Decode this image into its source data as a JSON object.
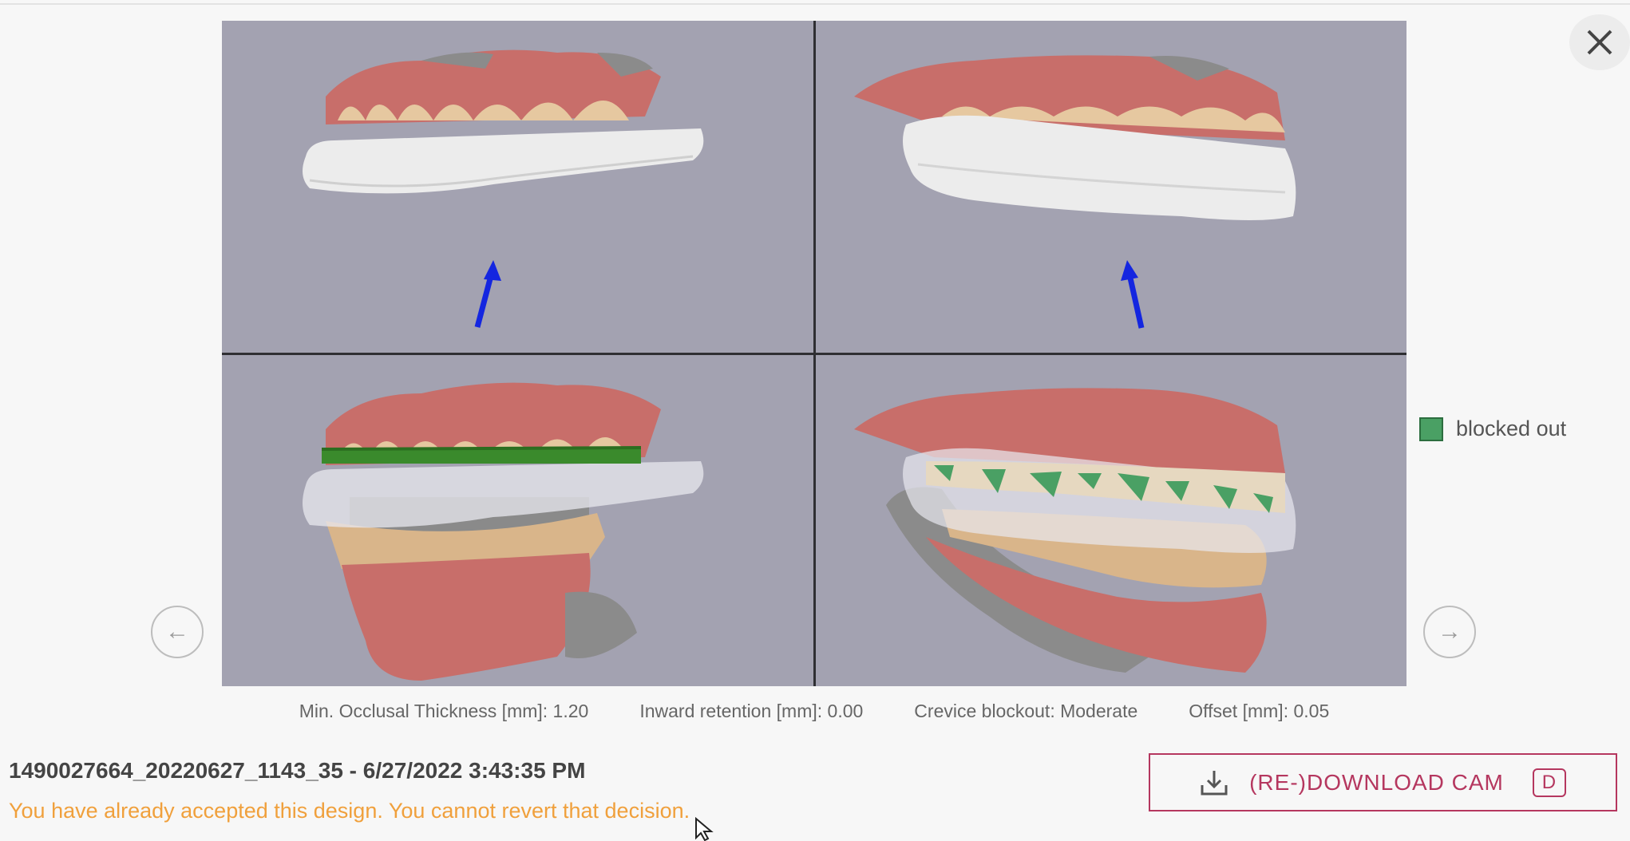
{
  "viewer": {
    "legend_label": "blocked out",
    "colors": {
      "background": "#a3a2b1",
      "gum": "#c86e6a",
      "tooth": "#e6c8a0",
      "splint": "#ececec",
      "blocked_out": "#4aa064",
      "arrow": "#1426e0"
    },
    "views": [
      "upper-left-lateral",
      "upper-right-lateral",
      "occlusion-left",
      "occlusion-right"
    ]
  },
  "params": {
    "min_occlusal_thickness": "Min. Occlusal Thickness [mm]: 1.20",
    "inward_retention": "Inward retention [mm]: 0.00",
    "crevice_blockout": "Crevice blockout: Moderate",
    "offset": "Offset [mm]: 0.05"
  },
  "design": {
    "title": "1490027664_20220627_1143_35 - 6/27/2022 3:43:35 PM",
    "warning": "You have already accepted this design. You cannot revert that decision."
  },
  "actions": {
    "download_label": "(RE-)DOWNLOAD CAM",
    "download_shortcut": "D",
    "prev_glyph": "←",
    "next_glyph": "→",
    "close_icon": "close-icon"
  }
}
